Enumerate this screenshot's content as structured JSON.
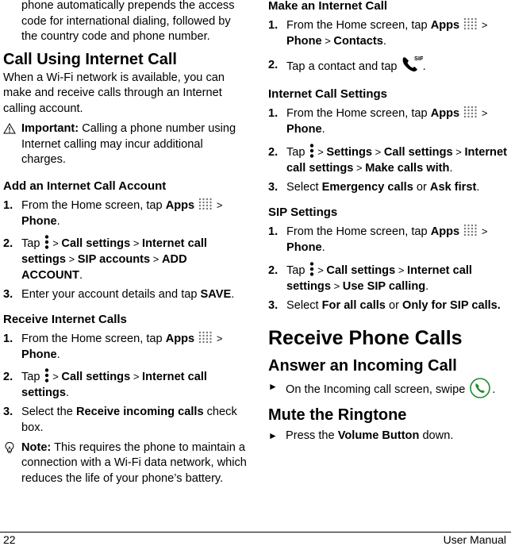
{
  "left": {
    "intro_continued": "phone automatically prepends the access code for international dialing, followed by the country code and phone number.",
    "section_title": "Call Using Internet Call",
    "section_body": "When a Wi-Fi network is available, you can make and receive calls through an Internet calling account.",
    "important": {
      "icon": "warning-triangle-icon",
      "label": "Important:",
      "text": " Calling a phone number using Internet calling may incur additional charges."
    },
    "add_account": {
      "title": "Add an Internet Call Account",
      "steps": [
        {
          "num": "1.",
          "a": "From the Home screen, tap ",
          "b1": "Apps",
          "c": " > ",
          "b2": "Phone",
          "d": "."
        },
        {
          "num": "2.",
          "a": "Tap ",
          "c1": " > ",
          "b1": "Call settings",
          "c2": " > ",
          "b2": "Internet call settings",
          "c3": " > ",
          "b3": "SIP accounts",
          "c4": " > ",
          "b4": "ADD ACCOUNT",
          "d": "."
        },
        {
          "num": "3.",
          "a": "Enter your account details and tap ",
          "b1": "SAVE",
          "d": "."
        }
      ]
    },
    "receive_calls": {
      "title": "Receive Internet Calls",
      "steps": [
        {
          "num": "1.",
          "a": "From the Home screen, tap ",
          "b1": "Apps",
          "c": " > ",
          "b2": "Phone",
          "d": "."
        },
        {
          "num": "2.",
          "a": "Tap ",
          "c1": " > ",
          "b1": "Call settings",
          "c2": " > ",
          "b2": "Internet call settings",
          "d": "."
        },
        {
          "num": "3.",
          "a": "Select the ",
          "b1": "Receive incoming calls",
          "d": " check box."
        }
      ]
    },
    "note": {
      "icon": "lightbulb-icon",
      "label": "Note:",
      "text": " This requires the phone to maintain a connection with a Wi-Fi data network, which reduces the life of your phone’s battery."
    }
  },
  "right": {
    "make_call": {
      "title": "Make an Internet Call",
      "steps": [
        {
          "num": "1.",
          "a": "From the Home screen, tap ",
          "b1": "Apps",
          "c": " > ",
          "b2": "Phone",
          "c2": " > ",
          "b3": "Contacts",
          "d": "."
        },
        {
          "num": "2.",
          "a": "Tap a contact and tap ",
          "d": "."
        }
      ],
      "sip_label": "SIP"
    },
    "settings": {
      "title": "Internet Call Settings",
      "steps": [
        {
          "num": "1.",
          "a": "From the Home screen, tap ",
          "b1": "Apps",
          "c": " > ",
          "b2": "Phone",
          "d": "."
        },
        {
          "num": "2.",
          "a": "Tap ",
          "c1": " > ",
          "b1": "Settings",
          "c2": " > ",
          "b2": "Call settings",
          "c3": " > ",
          "b3": "Internet call settings",
          "c4": " > ",
          "b4": "Make calls with",
          "d": "."
        },
        {
          "num": "3.",
          "a": "Select ",
          "b1": "Emergency calls",
          "c": " or ",
          "b2": "Ask first",
          "d": "."
        }
      ]
    },
    "sip": {
      "title": "SIP Settings",
      "steps": [
        {
          "num": "1.",
          "a": "From the Home screen, tap ",
          "b1": "Apps",
          "c": " > ",
          "b2": "Phone",
          "d": "."
        },
        {
          "num": "2.",
          "a": "Tap ",
          "c1": " > ",
          "b1": "Call settings",
          "c2": " > ",
          "b2": "Internet call settings",
          "c3": " > ",
          "b3": "Use SIP calling",
          "d": "."
        },
        {
          "num": "3.",
          "a": "Select ",
          "b1": "For all calls",
          "c": " or ",
          "b2": "Only for SIP calls."
        }
      ]
    },
    "chapter_title": "Receive Phone Calls",
    "answer": {
      "title": "Answer an Incoming Call",
      "bullet": "►",
      "text": "On the Incoming call screen, swipe ",
      "end": ".",
      "icon_color": "#1f8a2e"
    },
    "mute": {
      "title": "Mute the Ringtone",
      "bullet": "►",
      "a": "Press the ",
      "b": "Volume Button",
      "d": " down."
    }
  },
  "footer": {
    "page_number": "22",
    "title": "User Manual"
  }
}
